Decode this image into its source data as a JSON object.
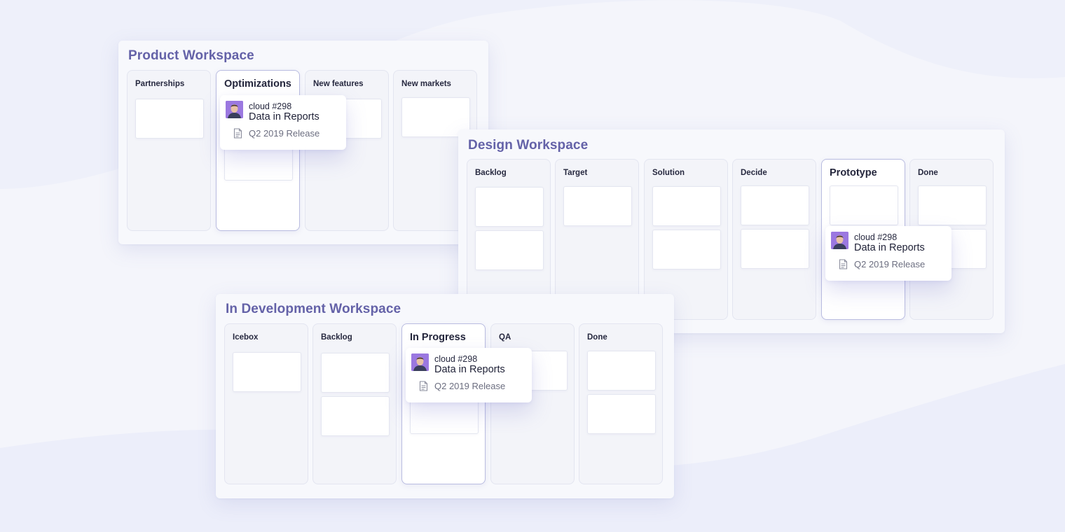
{
  "workspaces": {
    "product": {
      "title": "Product Workspace",
      "columns": [
        "Partnerships",
        "Optimizations",
        "New features",
        "New markets"
      ]
    },
    "design": {
      "title": "Design Workspace",
      "columns": [
        "Backlog",
        "Target",
        "Solution",
        "Decide",
        "Prototype",
        "Done"
      ]
    },
    "dev": {
      "title": "In Development Workspace",
      "columns": [
        "Icebox",
        "Backlog",
        "In Progress",
        "QA",
        "Done"
      ]
    }
  },
  "dragged_card": {
    "id": "cloud #298",
    "title": "Data in Reports",
    "release": "Q2 2019 Release",
    "icons": [
      "avatar",
      "document-icon"
    ]
  },
  "colors": {
    "accent": "#6462a8",
    "avatar_bg": "#8f6fd8",
    "background": "#f4f5fb"
  }
}
